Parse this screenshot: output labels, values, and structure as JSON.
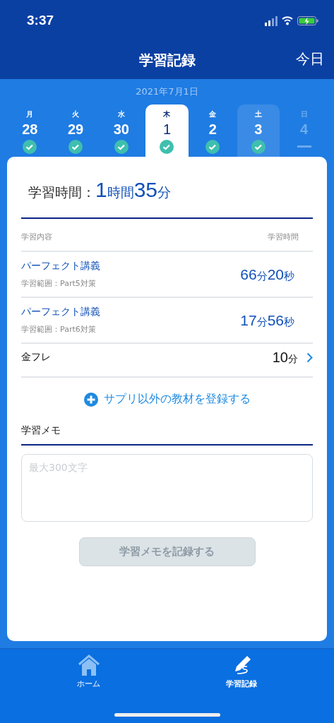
{
  "status_bar": {
    "time": "3:37"
  },
  "nav": {
    "title": "学習記録",
    "action": "今日"
  },
  "date_label": "2021年7月1日",
  "days": [
    {
      "weekday": "月",
      "date": "28",
      "kind": "done",
      "selected": false,
      "today": false
    },
    {
      "weekday": "火",
      "date": "29",
      "kind": "done",
      "selected": false,
      "today": false
    },
    {
      "weekday": "水",
      "date": "30",
      "kind": "done",
      "selected": false,
      "today": false
    },
    {
      "weekday": "木",
      "date": "1",
      "kind": "done",
      "selected": true,
      "today": false
    },
    {
      "weekday": "金",
      "date": "2",
      "kind": "done",
      "selected": false,
      "today": false
    },
    {
      "weekday": "土",
      "date": "3",
      "kind": "done",
      "selected": false,
      "today": true
    },
    {
      "weekday": "日",
      "date": "4",
      "kind": "future",
      "selected": false,
      "today": false
    }
  ],
  "total": {
    "label": "学習時間：",
    "parts": [
      "1",
      "時間",
      "35",
      "分"
    ]
  },
  "table": {
    "columns": [
      "学習内容",
      "学習時間"
    ],
    "rows": [
      {
        "kind": "lecture",
        "title": "パーフェクト講義",
        "subtitle": "学習範囲：Part5対策",
        "parts": [
          "66",
          "分",
          "20",
          "秒"
        ]
      },
      {
        "kind": "lecture",
        "title": "パーフェクト講義",
        "subtitle": "学習範囲：Part6対策",
        "parts": [
          "17",
          "分",
          "56",
          "秒"
        ]
      },
      {
        "kind": "other",
        "title": "金フレ",
        "parts": [
          "10",
          "分"
        ]
      }
    ]
  },
  "add_link": "サプリ以外の教材を登録する",
  "memo": {
    "heading": "学習メモ",
    "placeholder": "最大300文字",
    "button": "学習メモを記録する",
    "disabled": true
  },
  "tab_bar": [
    {
      "label": "ホーム",
      "selected": false
    },
    {
      "label": "学習記録",
      "selected": true
    }
  ]
}
